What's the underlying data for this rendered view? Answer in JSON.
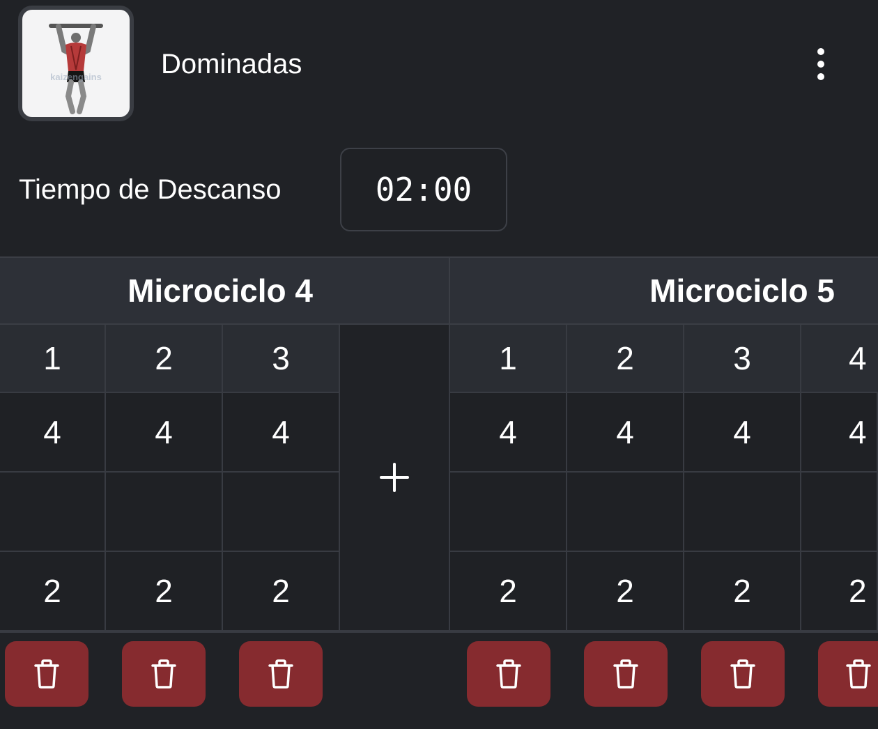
{
  "exercise": {
    "name": "Dominadas",
    "thumbnail_watermark": "kaizengains",
    "menu_icon": "more-vertical-icon"
  },
  "rest": {
    "label": "Tiempo de Descanso",
    "value": "02:00"
  },
  "microcycles": [
    {
      "title": "Microciclo 4",
      "sets": [
        "1",
        "2",
        "3"
      ],
      "row1": [
        "4",
        "4",
        "4"
      ],
      "row2": [
        "",
        "",
        ""
      ],
      "row3": [
        "2",
        "2",
        "2"
      ]
    },
    {
      "title": "Microciclo 5",
      "sets": [
        "1",
        "2",
        "3",
        "4"
      ],
      "row1": [
        "4",
        "4",
        "4",
        "4"
      ],
      "row2": [
        "",
        "",
        "",
        ""
      ],
      "row3": [
        "2",
        "2",
        "2",
        "2"
      ]
    }
  ],
  "add_set": {
    "icon": "plus-icon",
    "label": "+"
  },
  "delete_icon": "trash-icon",
  "colors": {
    "background": "#202226",
    "header_cell": "#2d3037",
    "border": "#383b42",
    "delete_button": "#862b2f"
  }
}
